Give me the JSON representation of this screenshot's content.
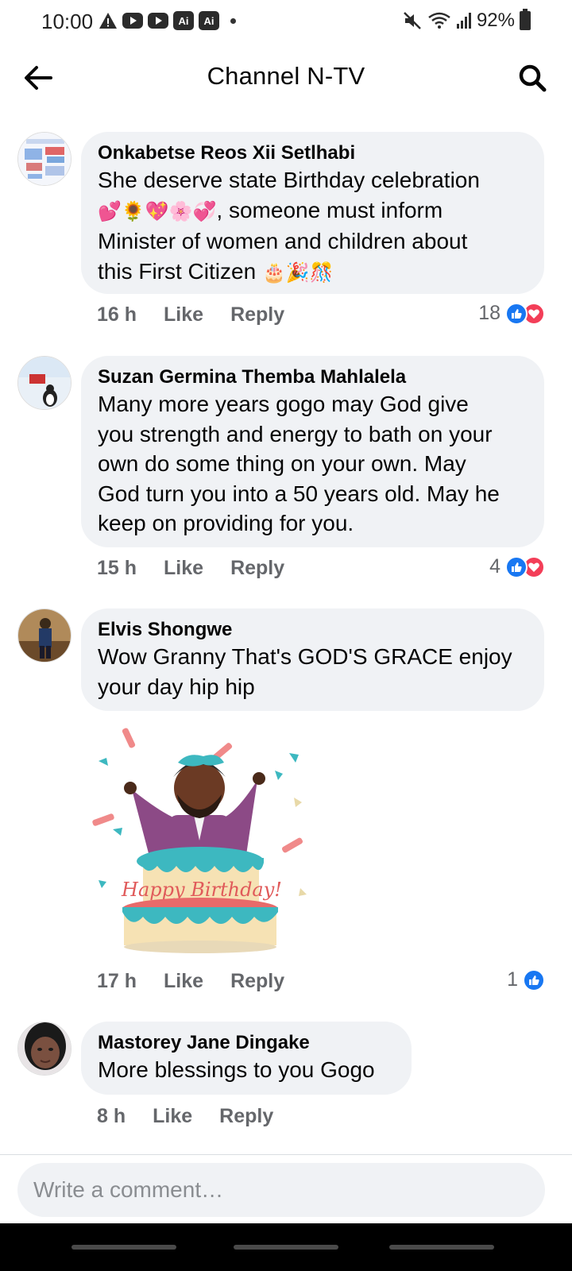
{
  "status_bar": {
    "time": "10:00",
    "battery": "92%",
    "notification_icons": [
      "warning-icon",
      "youtube-icon",
      "youtube-icon",
      "ai-icon",
      "ai-icon"
    ],
    "ai_label": "Ai",
    "system_icons": [
      "mute-icon",
      "wifi-icon",
      "signal-icon",
      "battery-icon"
    ]
  },
  "header": {
    "title": "Channel N-TV",
    "back_icon": "arrow-left-icon",
    "search_icon": "search-icon"
  },
  "colors": {
    "bubble": "#f0f2f5",
    "meta_text": "#65676b",
    "like": "#1877f2",
    "love": "#f33e58"
  },
  "comments": [
    {
      "author": "Onkabetse Reos Xii Setlhabi",
      "text_lines": [
        "She deserve state Birthday celebration",
        ", someone must inform",
        "Minister of women and children  about",
        "this First Citizen "
      ],
      "emoji_line2": "💕🌻💖🌸💞",
      "emoji_line4": "🎂🎉🎊",
      "time": "16 h",
      "like_label": "Like",
      "reply_label": "Reply",
      "reaction_count": "18",
      "reactions": [
        "like",
        "love"
      ]
    },
    {
      "author": "Suzan Germina Themba Mahlalela",
      "text_lines": [
        "Many more years gogo may God give",
        "you strength and energy to bath on your",
        "own do some thing on your own. May",
        "God turn you into a 50 years old. May he",
        "keep on providing for you."
      ],
      "time": "15 h",
      "like_label": "Like",
      "reply_label": "Reply",
      "reaction_count": "4",
      "reactions": [
        "like",
        "love"
      ]
    },
    {
      "author": "Elvis Shongwe",
      "text_lines": [
        "Wow Granny That's GOD'S GRACE enjoy",
        "your day hip hip"
      ],
      "sticker": {
        "name": "happy-birthday-sticker",
        "text": "Happy Birthday!"
      },
      "time": "17 h",
      "like_label": "Like",
      "reply_label": "Reply",
      "reaction_count": "1",
      "reactions": [
        "like"
      ]
    },
    {
      "author": "Mastorey Jane Dingake",
      "text_lines": [
        "More blessings to you Gogo"
      ],
      "time": "8 h",
      "like_label": "Like",
      "reply_label": "Reply"
    }
  ],
  "composer": {
    "placeholder": "Write a comment…",
    "value": ""
  }
}
